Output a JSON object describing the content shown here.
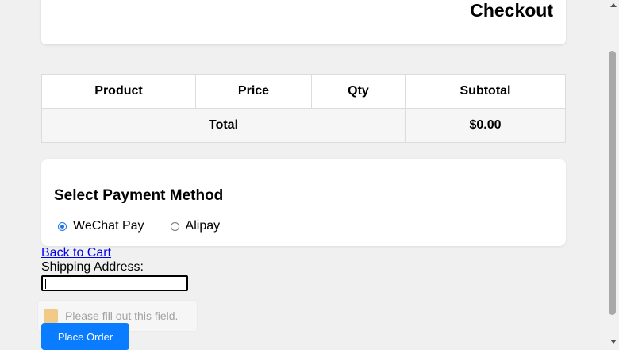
{
  "header": {
    "title": "Checkout"
  },
  "cart_table": {
    "columns": [
      "Product",
      "Price",
      "Qty",
      "Subtotal"
    ],
    "total_label": "Total",
    "total_value": "$0.00"
  },
  "payment": {
    "title": "Select Payment Method",
    "options": [
      {
        "label": "WeChat Pay",
        "selected": true
      },
      {
        "label": "Alipay",
        "selected": false
      }
    ]
  },
  "links": {
    "back_to_cart": "Back to Cart"
  },
  "shipping": {
    "label": "Shipping Address:",
    "value": ""
  },
  "validation": {
    "message": "Please fill out this field."
  },
  "actions": {
    "place_order": "Place Order"
  },
  "colors": {
    "primary_button": "#0a7cff",
    "radio_accent": "#1a73e8",
    "link": "#0000ee"
  }
}
